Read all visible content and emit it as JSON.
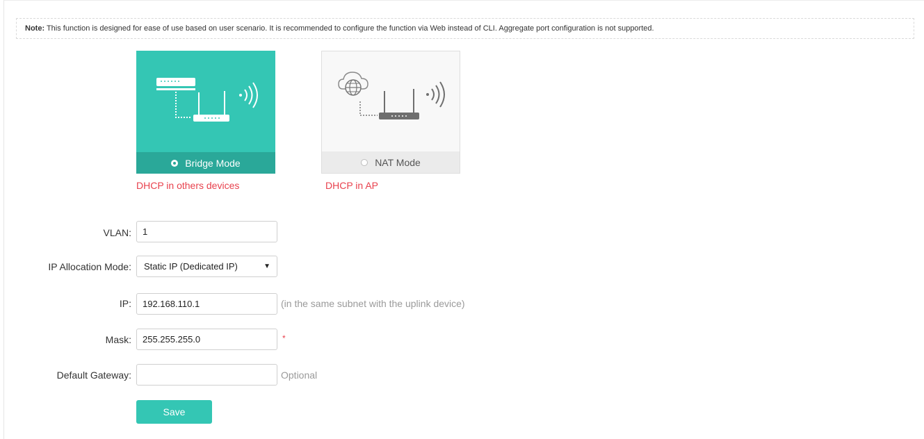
{
  "note": {
    "label": "Note:",
    "text": " This function is designed for ease of use based on user scenario. It is recommended to configure the function via Web instead of CLI. Aggregate port configuration is not supported."
  },
  "modes": [
    {
      "label": "Bridge Mode",
      "description": "DHCP in others devices",
      "selected": true
    },
    {
      "label": "NAT Mode",
      "description": "DHCP in AP",
      "selected": false
    }
  ],
  "form": {
    "vlan": {
      "label": "VLAN:",
      "value": "1"
    },
    "ip_mode": {
      "label": "IP Allocation Mode:",
      "value": "Static IP (Dedicated IP)"
    },
    "ip": {
      "label": "IP:",
      "value": "192.168.110.1",
      "hint": "(in the same subnet with the uplink device)"
    },
    "mask": {
      "label": "Mask:",
      "value": "255.255.255.0",
      "required_mark": "*"
    },
    "gateway": {
      "label": "Default Gateway:",
      "value": "",
      "hint": "Optional"
    }
  },
  "save_label": "Save",
  "colors": {
    "accent": "#34c6b4",
    "accent_dark": "#2aa899",
    "error": "#e8414d"
  }
}
